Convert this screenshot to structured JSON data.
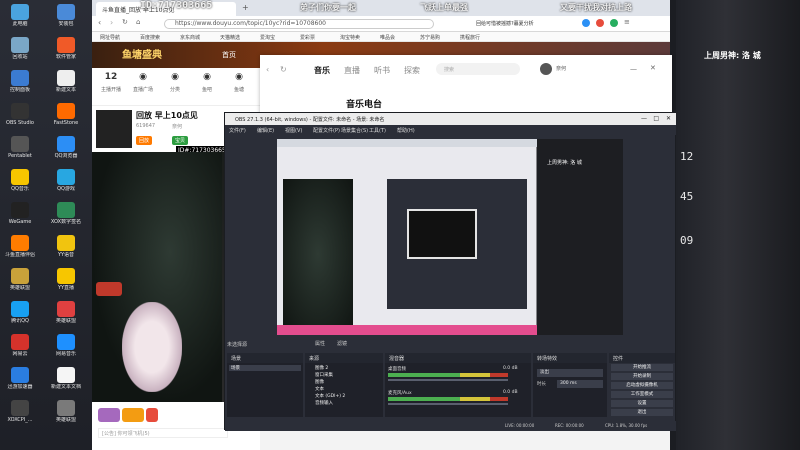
{
  "desktop": {
    "icons": [
      {
        "label": "此电脑",
        "color": "#4aa3df"
      },
      {
        "label": "回收站",
        "color": "#7aa7c7"
      },
      {
        "label": "控制面板",
        "color": "#3b7bd1"
      },
      {
        "label": "OBS Studio",
        "color": "#333333"
      },
      {
        "label": "Pentablet",
        "color": "#555555"
      },
      {
        "label": "QQ音乐",
        "color": "#f7c600"
      },
      {
        "label": "WeGame",
        "color": "#222222"
      },
      {
        "label": "斗鱼直播伴侣",
        "color": "#ff7c00"
      },
      {
        "label": "英雄联盟",
        "color": "#c9a23a"
      },
      {
        "label": "腾讯QQ",
        "color": "#18a0f2"
      },
      {
        "label": "网易云",
        "color": "#d5322b"
      },
      {
        "label": "迅游加速器",
        "color": "#2a7de1"
      },
      {
        "label": "XOXCPI_...",
        "color": "#444444"
      }
    ],
    "icons_col2": [
      {
        "label": "安装包",
        "color": "#4a8ad8"
      },
      {
        "label": "软件管家",
        "color": "#f05a28"
      },
      {
        "label": "新建文本",
        "color": "#eeeeee"
      },
      {
        "label": "FastStone",
        "color": "#ff6a00"
      },
      {
        "label": "QQ浏览器",
        "color": "#2c8ef5"
      },
      {
        "label": "QQ游戏",
        "color": "#28a7e1"
      },
      {
        "label": "XOX数字签名",
        "color": "#2e8b57"
      },
      {
        "label": "YY语音",
        "color": "#f1c40f"
      },
      {
        "label": "YY直播",
        "color": "#f7c600"
      },
      {
        "label": "英雄联盟",
        "color": "#e04040"
      },
      {
        "label": "网易音乐",
        "color": "#1e90ff"
      },
      {
        "label": "新建文本文档",
        "color": "#f5f5f5"
      },
      {
        "label": "英雄联盟",
        "color": "#7a7a7a"
      }
    ]
  },
  "overlay": {
    "left_text": "ID:717303665",
    "mid_text": "弟子们你要一起",
    "mid2_text": "飞跃上单最强",
    "right_text": "又要干扰我对抗上路"
  },
  "browser": {
    "tab_title": "斗鱼直播_回放 早上10点见",
    "url": "https://www.douyu.com/topic/10yc?rid=10708600",
    "search_hint": "回给可惜被摇撼?暮夏分析",
    "bookmarks": [
      "网址导航",
      "百度搜索",
      "京东商城",
      "天猫精选",
      "爱淘宝",
      "爱彩票",
      "淘宝特卖",
      "唯品会",
      "苏宁易购",
      "携程旅行"
    ]
  },
  "douyu": {
    "brand": "鱼塘盛典",
    "nav_first": "首页",
    "side_items": [
      {
        "count": "12",
        "label": "主播开播"
      },
      {
        "count": "",
        "label": "直播广场"
      },
      {
        "count": "",
        "label": "分类"
      },
      {
        "count": "",
        "label": "鱼吧"
      },
      {
        "count": "",
        "label": "鱼塘"
      }
    ],
    "room_title": "回放 早上10点见",
    "room_id": "ID#:717303665",
    "room_tag": "回放",
    "streamer": "奈何",
    "fans_num": "619647",
    "guard_badge": "宝贝",
    "chat_input": "[公告] 你可领飞机(5)"
  },
  "qqmusic": {
    "tabs": [
      "音乐",
      "直播",
      "听书",
      "探索"
    ],
    "search_placeholder": "搜索",
    "user": "奈何",
    "title": "音乐电台"
  },
  "obs": {
    "title": "OBS 27.1.3 (64-bit, windows) - 配置文件: 未命名 - 场景: 未命名",
    "menu": [
      "文件(F)",
      "编辑(E)",
      "视图(V)",
      "配置文件(P)",
      "场景集合(S)",
      "工具(T)",
      "帮助(H)"
    ],
    "panels": {
      "scenes": "场景",
      "sources": "来源",
      "mixer": "混音器",
      "transitions": "转场特效",
      "controls": "控件"
    },
    "scene_items": [
      "场景"
    ],
    "source_items": [
      "图像 2",
      "窗口采集",
      "图像",
      "文本",
      "文本 (GDI+) 2",
      "音频输入"
    ],
    "mixer": [
      {
        "name": "桌面音频",
        "db": "0.0 dB"
      },
      {
        "name": "麦克风/Aux",
        "db": "0.0 dB"
      }
    ],
    "transition": {
      "type": "淡出",
      "duration_label": "时长",
      "duration": "300 ms"
    },
    "controls": [
      "开始推流",
      "开始录制",
      "启动虚拟摄像机",
      "工作室模式",
      "设置",
      "退出"
    ],
    "not_selected": "未选择源",
    "props": "属性",
    "filters": "滤镜",
    "status": {
      "live": "LIVE: 00:00:00",
      "rec": "REC: 00:00:00",
      "cpu": "CPU: 1.8%, 30.00 fps"
    }
  },
  "right": {
    "clock_lines": [
      "12",
      "45",
      "09"
    ],
    "banner": "上周男神: 洛 城"
  }
}
